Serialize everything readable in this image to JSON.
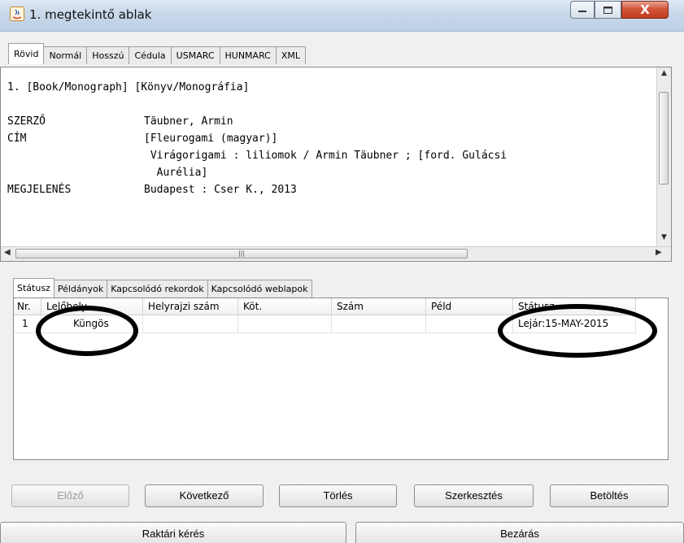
{
  "window": {
    "title": "1. megtekintő ablak",
    "close_glyph": "X"
  },
  "format_tabs": [
    "Rövid",
    "Normál",
    "Hosszú",
    "Cédula",
    "USMARC",
    "HUNMARC",
    "XML"
  ],
  "record": {
    "line1": "1. [Book/Monograph] [Könyv/Monográfia]",
    "author_label": "SZERZŐ",
    "author_value": "Täubner, Armin",
    "title_label": "CÍM",
    "title_value1": "[Fleurogami (magyar)]",
    "title_value2": " Virágorigami : liliomok / Armin Täubner ; [ford. Gulácsi",
    "title_value3": "  Aurélia]",
    "pub_label": "MEGJELENÉS",
    "pub_value": "Budapest : Cser K., 2013"
  },
  "info_tabs": [
    "Státusz",
    "Példányok",
    "Kapcsolódó rekordok",
    "Kapcsolódó weblapok"
  ],
  "table": {
    "columns": [
      "Nr.",
      "Lelőhely",
      "Helyrajzi szám",
      "Köt.",
      "Szám",
      "Péld",
      "Státusz"
    ],
    "rows": [
      {
        "nr": "1",
        "lelohely": "Küngös",
        "helyrajzi": "",
        "kot": "",
        "szam": "",
        "peld": "",
        "statusz": "Lejár:15-MAY-2015"
      }
    ]
  },
  "buttons": {
    "prev": "Előző",
    "next": "Következő",
    "delete": "Törlés",
    "edit": "Szerkesztés",
    "load": "Betöltés",
    "request": "Raktári kérés",
    "close": "Bezárás"
  }
}
